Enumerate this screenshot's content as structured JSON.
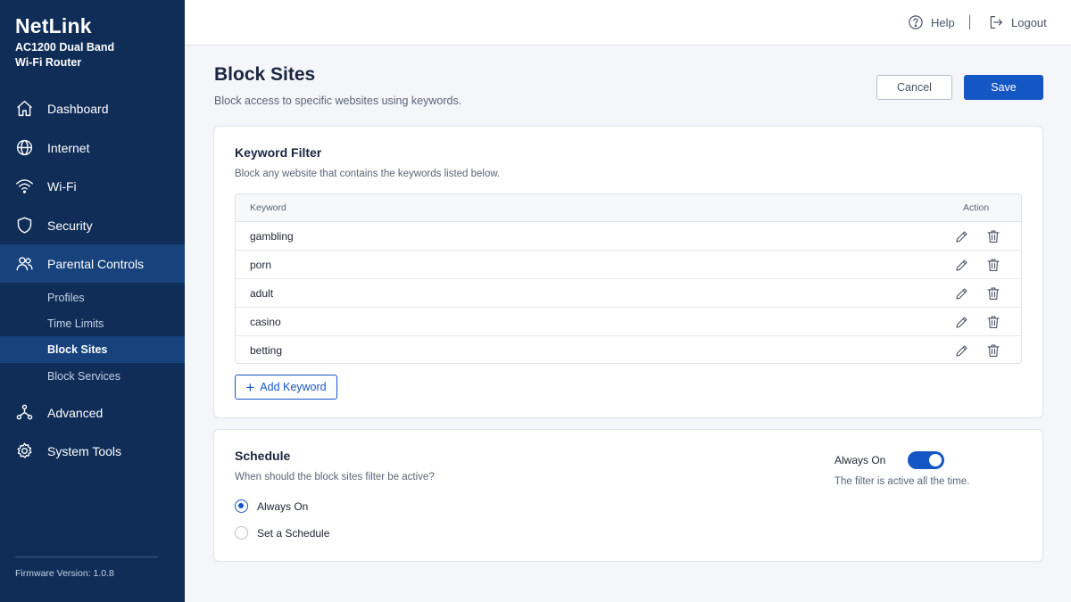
{
  "brand": {
    "name": "NetLink",
    "model": "AC1200 Dual Band Wi-Fi Router"
  },
  "sidebar": {
    "items": [
      {
        "label": "Dashboard",
        "icon": "home-icon"
      },
      {
        "label": "Internet",
        "icon": "globe-icon"
      },
      {
        "label": "Wi-Fi",
        "icon": "wifi-icon"
      },
      {
        "label": "Security",
        "icon": "shield-icon"
      },
      {
        "label": "Parental Controls",
        "icon": "users-icon",
        "active": true
      },
      {
        "label": "Advanced",
        "icon": "network-icon"
      },
      {
        "label": "System Tools",
        "icon": "gear-icon"
      }
    ],
    "subitems": [
      {
        "label": "Profiles"
      },
      {
        "label": "Time Limits"
      },
      {
        "label": "Block Sites",
        "active": true
      },
      {
        "label": "Block Services"
      }
    ],
    "firmware": "Firmware Version: 1.0.8"
  },
  "topbar": {
    "help": "Help",
    "logout": "Logout"
  },
  "page": {
    "title": "Block Sites",
    "subtitle": "Block access to specific websites using keywords.",
    "cancel": "Cancel",
    "save": "Save"
  },
  "keyword_filter": {
    "title": "Keyword Filter",
    "description": "Block any website that contains the keywords listed below.",
    "col_keyword": "Keyword",
    "col_action": "Action",
    "rows": [
      "gambling",
      "porn",
      "adult",
      "casino",
      "betting"
    ],
    "add_label": "Add Keyword"
  },
  "schedule": {
    "title": "Schedule",
    "question": "When should the block sites filter be active?",
    "options": [
      {
        "label": "Always On",
        "selected": true
      },
      {
        "label": "Set a Schedule",
        "selected": false
      }
    ],
    "toggle_label": "Always On",
    "toggle_on": true,
    "toggle_hint": "The filter is active all the time."
  },
  "colors": {
    "sidebar": "#0f2d57",
    "sidebar_active": "#17427c",
    "accent": "#1456c4"
  }
}
